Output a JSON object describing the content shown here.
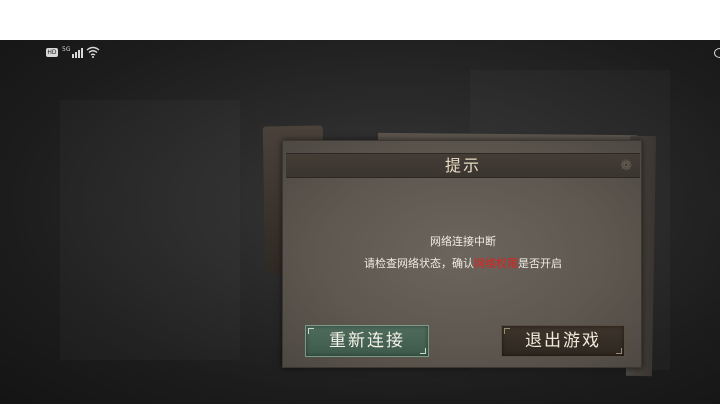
{
  "status_bar": {
    "hd_label": "HD",
    "network_label": "5G",
    "icons": [
      "hd-icon",
      "signal-icon",
      "wifi-icon",
      "eye-icon"
    ]
  },
  "dialog": {
    "title": "提示",
    "message_line1": "网络连接中断",
    "message_line2_prefix": "请检查网络状态，确认",
    "message_line2_highlight": "网络权限",
    "message_line2_suffix": "是否开启",
    "highlight_color": "#e02020"
  },
  "buttons": {
    "reconnect_label": "重新连接",
    "quit_label": "退出游戏"
  }
}
